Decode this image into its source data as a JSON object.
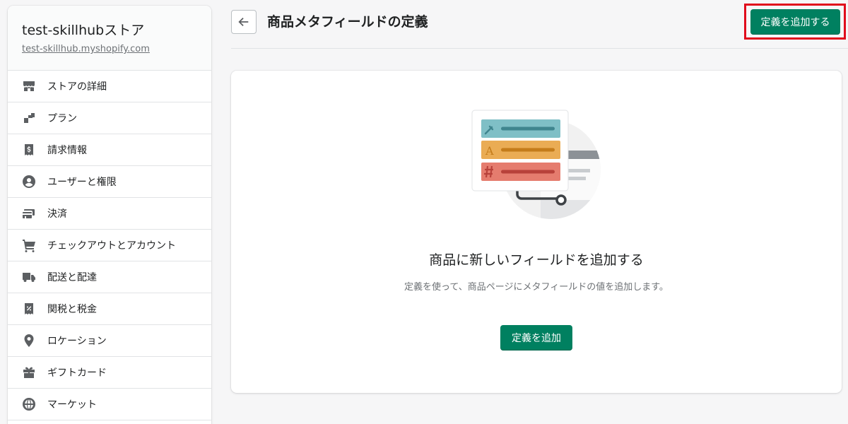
{
  "store": {
    "name": "test-skillhubストア",
    "url": "test-skillhub.myshopify.com"
  },
  "sidebar": {
    "items": [
      {
        "label": "ストアの詳細",
        "icon": "store-icon"
      },
      {
        "label": "プラン",
        "icon": "plan-icon"
      },
      {
        "label": "請求情報",
        "icon": "billing-icon"
      },
      {
        "label": "ユーザーと権限",
        "icon": "user-icon"
      },
      {
        "label": "決済",
        "icon": "payments-icon"
      },
      {
        "label": "チェックアウトとアカウント",
        "icon": "cart-icon"
      },
      {
        "label": "配送と配達",
        "icon": "truck-icon"
      },
      {
        "label": "関税と税金",
        "icon": "tax-icon"
      },
      {
        "label": "ロケーション",
        "icon": "location-icon"
      },
      {
        "label": "ギフトカード",
        "icon": "gift-icon"
      },
      {
        "label": "マーケット",
        "icon": "globe-icon"
      }
    ]
  },
  "header": {
    "title": "商品メタフィールドの定義",
    "add_definition_button": "定義を追加する"
  },
  "empty_state": {
    "heading": "商品に新しいフィールドを追加する",
    "description": "定義を使って、商品ページにメタフィールドの値を追加します。",
    "button": "定義を追加"
  },
  "colors": {
    "primary": "#008060",
    "highlight": "#e00b1c"
  }
}
